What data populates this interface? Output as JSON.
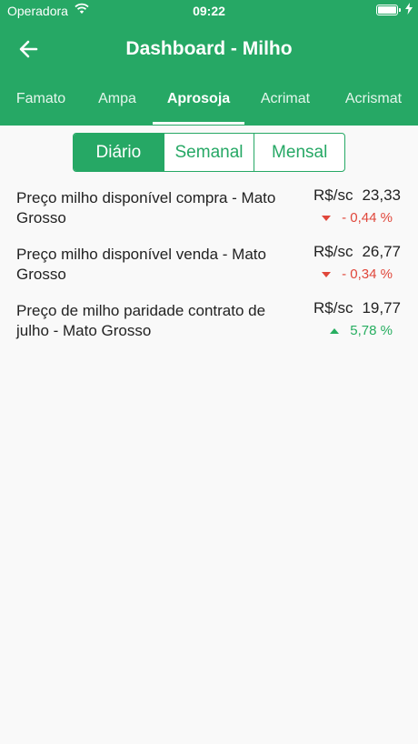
{
  "status_bar": {
    "carrier": "Operadora",
    "time": "09:22",
    "wifi_icon": "wifi-icon",
    "battery_icon": "battery-icon",
    "charging_icon": "bolt-icon"
  },
  "header": {
    "title": "Dashboard - Milho",
    "back_icon": "arrow-left-icon"
  },
  "tabs": [
    {
      "label": "Famato",
      "active": false
    },
    {
      "label": "Ampa",
      "active": false
    },
    {
      "label": "Aprosoja",
      "active": true
    },
    {
      "label": "Acrimat",
      "active": false
    },
    {
      "label": "Acrismat",
      "active": false
    }
  ],
  "period_selector": [
    {
      "label": "Diário",
      "active": true
    },
    {
      "label": "Semanal",
      "active": false
    },
    {
      "label": "Mensal",
      "active": false
    }
  ],
  "prices": [
    {
      "name": "Preço milho disponível compra - Mato Grosso",
      "unit": "R$/sc",
      "value": "23,33",
      "change": "- 0,44 %",
      "direction": "down"
    },
    {
      "name": "Preço milho disponível venda - Mato Grosso",
      "unit": "R$/sc",
      "value": "26,77",
      "change": "- 0,34 %",
      "direction": "down"
    },
    {
      "name": "Preço de milho paridade contrato de julho - Mato Grosso",
      "unit": "R$/sc",
      "value": "19,77",
      "change": "5,78 %",
      "direction": "up"
    }
  ],
  "colors": {
    "brand": "#26a865",
    "negative": "#e0473b",
    "positive": "#27ae60"
  }
}
